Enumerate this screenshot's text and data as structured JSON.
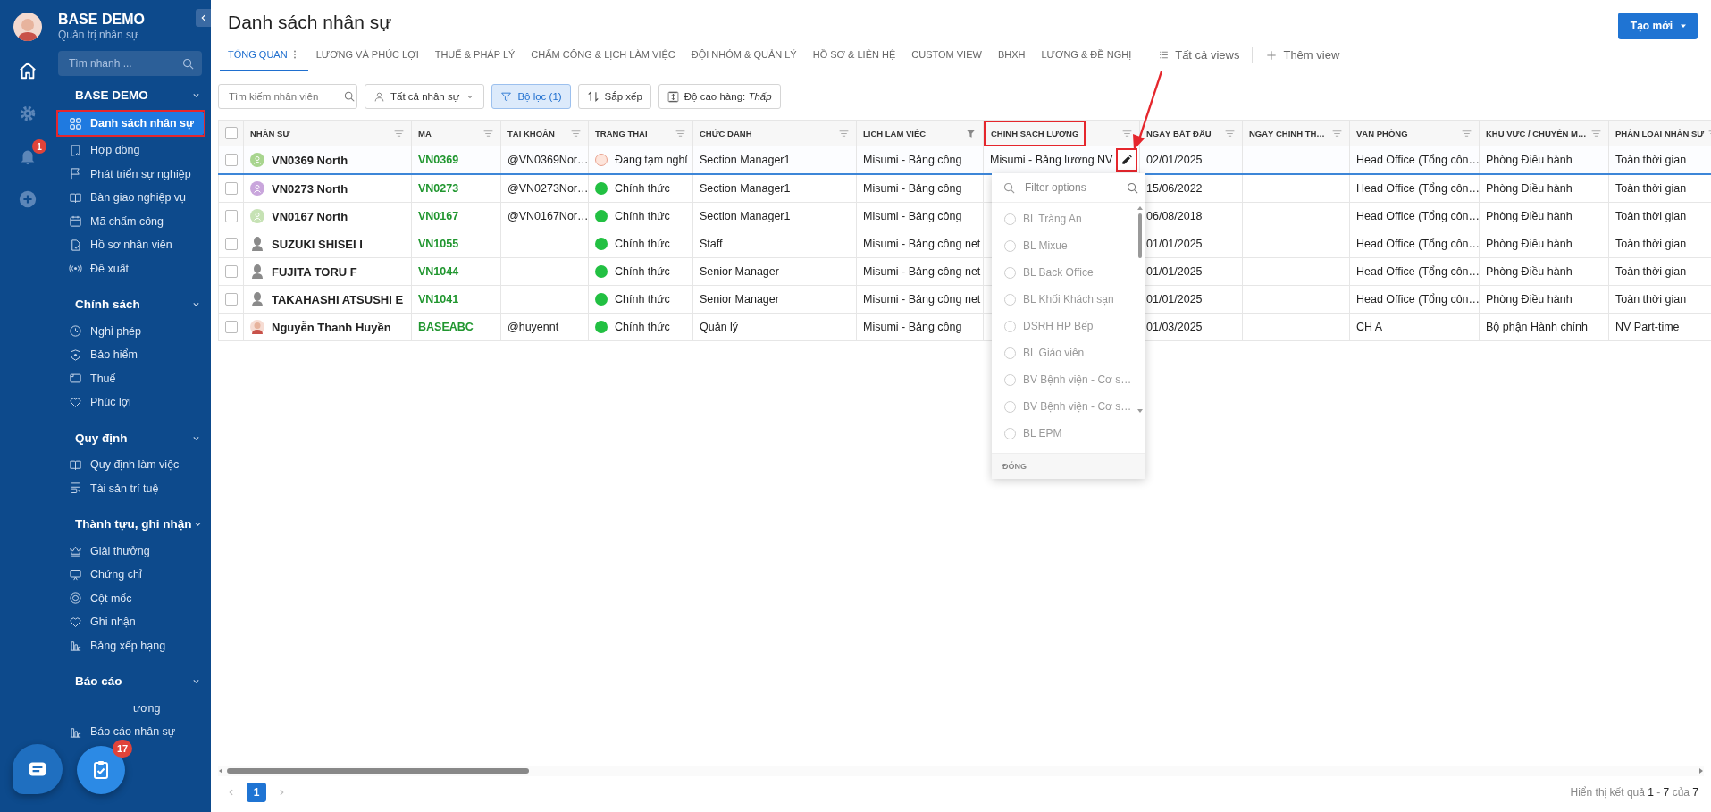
{
  "sidebar": {
    "workspace": "BASE DEMO",
    "subtitle": "Quản trị nhân sự",
    "notification_count": "1",
    "search": {
      "placeholder": "Tìm nhanh ..."
    },
    "sections": [
      {
        "title": "BASE DEMO",
        "expanded": true,
        "items": [
          {
            "label": "Danh sách nhân sự",
            "selected": true,
            "highlighted": true
          },
          {
            "label": "Hợp đồng",
            "selected": false
          },
          {
            "label": "Phát triển sự nghiệp",
            "selected": false
          },
          {
            "label": "Bàn giao nghiệp vụ",
            "selected": false
          },
          {
            "label": "Mã chấm công",
            "selected": false
          },
          {
            "label": "Hồ sơ nhân viên",
            "selected": false
          },
          {
            "label": "Đề xuất",
            "selected": false
          }
        ]
      },
      {
        "title": "Chính sách",
        "expanded": true,
        "items": [
          {
            "label": "Nghỉ phép",
            "selected": false
          },
          {
            "label": "Bảo hiểm",
            "selected": false
          },
          {
            "label": "Thuế",
            "selected": false
          },
          {
            "label": "Phúc lợi",
            "selected": false
          }
        ]
      },
      {
        "title": "Quy định",
        "expanded": true,
        "items": [
          {
            "label": "Quy định làm việc",
            "selected": false
          },
          {
            "label": "Tài sản trí tuệ",
            "selected": false
          }
        ]
      },
      {
        "title": "Thành tựu, ghi nhận",
        "expanded": true,
        "items": [
          {
            "label": "Giải thưởng",
            "selected": false
          },
          {
            "label": "Chứng chỉ",
            "selected": false
          },
          {
            "label": "Cột mốc",
            "selected": false
          },
          {
            "label": "Ghi nhận",
            "selected": false
          },
          {
            "label": "Bảng xếp hạng",
            "selected": false
          }
        ]
      },
      {
        "title": "Báo cáo",
        "expanded": true,
        "items": [
          {
            "label": "ương",
            "selected": false,
            "kind": "covered"
          },
          {
            "label": "Báo cáo nhân sự",
            "selected": false
          }
        ]
      }
    ]
  },
  "floating": {
    "task_count": "17"
  },
  "page": {
    "title": "Danh sách nhân sự",
    "create_button": "Tạo mới"
  },
  "tabs": [
    {
      "label": "TỔNG QUAN",
      "selected": true
    },
    {
      "label": "LƯƠNG VÀ PHÚC LỢI",
      "selected": false
    },
    {
      "label": "THUẾ & PHÁP LÝ",
      "selected": false
    },
    {
      "label": "CHẤM CÔNG & LỊCH LÀM VIỆC",
      "selected": false
    },
    {
      "label": "ĐỘI NHÓM & QUẢN LÝ",
      "selected": false
    },
    {
      "label": "HỒ SƠ & LIÊN HỆ",
      "selected": false
    },
    {
      "label": "CUSTOM VIEW",
      "selected": false
    },
    {
      "label": "BHXH",
      "selected": false
    },
    {
      "label": "LƯƠNG & ĐỀ NGHỊ",
      "selected": false
    }
  ],
  "view_actions": {
    "all_views": "Tất cả views",
    "add_view": "Thêm view"
  },
  "toolbar": {
    "search": {
      "placeholder": "Tìm kiếm nhân viên"
    },
    "scope": "Tất cả nhân sự",
    "filter": {
      "label": "Bộ lọc (1)",
      "active": true
    },
    "sort": "Sắp xếp",
    "row_height": "Độ cao hàng: *Thấp*"
  },
  "table": {
    "all_checked": false,
    "columns": [
      {
        "label": "NHÂN SỰ",
        "filtered": false
      },
      {
        "label": "MÃ",
        "filtered": false
      },
      {
        "label": "TÀI KHOẢN",
        "filtered": false
      },
      {
        "label": "TRẠNG THÁI",
        "filtered": false
      },
      {
        "label": "CHỨC DANH",
        "filtered": false
      },
      {
        "label": "LỊCH LÀM VIỆC",
        "filtered": true
      },
      {
        "label": "CHÍNH SÁCH LƯƠNG",
        "filtered": false,
        "highlighted": true
      },
      {
        "label": "NGÀY BẮT ĐẦU",
        "filtered": false
      },
      {
        "label": "NGÀY CHÍNH TH…",
        "filtered": false
      },
      {
        "label": "VĂN PHÒNG",
        "filtered": false
      },
      {
        "label": "KHU VỰC / CHUYÊN M…",
        "filtered": false
      },
      {
        "label": "PHÂN LOẠI NHÂN SỰ",
        "filtered": false
      }
    ],
    "rows": [
      {
        "checked": false,
        "editing": true,
        "name": "VN0369 North",
        "avatar": {
          "kind": "initial",
          "color": "#a8d58f"
        },
        "code": "VN0369",
        "account": "@VN0369Nor…",
        "status": {
          "label": "Đang tạm nghỉ",
          "kind": "paused"
        },
        "title": "Section Manager1",
        "schedule": "Misumi - Bảng công",
        "policy": "Misumi - Bảng lương NV",
        "start": "02/01/2025",
        "office": "Head Office (Tổng côn…",
        "region": "Phòng Điều hành",
        "type": "Toàn thời gian"
      },
      {
        "checked": false,
        "editing": false,
        "name": "VN0273 North",
        "avatar": {
          "kind": "initial",
          "color": "#c9a6dc"
        },
        "code": "VN0273",
        "account": "@VN0273Nor…",
        "status": {
          "label": "Chính thức",
          "kind": "official"
        },
        "title": "Section Manager1",
        "schedule": "Misumi - Bảng công",
        "start": "15/06/2022",
        "office": "Head Office (Tổng côn…",
        "region": "Phòng Điều hành",
        "type": "Toàn thời gian"
      },
      {
        "checked": false,
        "editing": false,
        "name": "VN0167 North",
        "avatar": {
          "kind": "initial",
          "color": "#c6e2b4"
        },
        "code": "VN0167",
        "account": "@VN0167Nor…",
        "status": {
          "label": "Chính thức",
          "kind": "official"
        },
        "title": "Section Manager1",
        "schedule": "Misumi - Bảng công",
        "start": "06/08/2018",
        "office": "Head Office (Tổng côn…",
        "region": "Phòng Điều hành",
        "type": "Toàn thời gian"
      },
      {
        "checked": false,
        "editing": false,
        "name": "SUZUKI SHISEI I",
        "avatar": {
          "kind": "silhouette"
        },
        "code": "VN1055",
        "status": {
          "label": "Chính thức",
          "kind": "official"
        },
        "title": "Staff",
        "schedule": "Misumi - Bảng công net",
        "start": "01/01/2025",
        "office": "Head Office (Tổng côn…",
        "region": "Phòng Điều hành",
        "type": "Toàn thời gian"
      },
      {
        "checked": false,
        "editing": false,
        "name": "FUJITA TORU F",
        "avatar": {
          "kind": "silhouette"
        },
        "code": "VN1044",
        "status": {
          "label": "Chính thức",
          "kind": "official"
        },
        "title": "Senior Manager",
        "schedule": "Misumi - Bảng công net",
        "start": "01/01/2025",
        "office": "Head Office (Tổng côn…",
        "region": "Phòng Điều hành",
        "type": "Toàn thời gian"
      },
      {
        "checked": false,
        "editing": false,
        "name": "TAKAHASHI ATSUSHI E",
        "avatar": {
          "kind": "silhouette"
        },
        "code": "VN1041",
        "status": {
          "label": "Chính thức",
          "kind": "official"
        },
        "title": "Senior Manager",
        "schedule": "Misumi - Bảng công net",
        "start": "01/01/2025",
        "office": "Head Office (Tổng côn…",
        "region": "Phòng Điều hành",
        "type": "Toàn thời gian"
      },
      {
        "checked": false,
        "editing": false,
        "name": "Nguyễn Thanh Huyền",
        "avatar": {
          "kind": "figure"
        },
        "code": "BASEABC",
        "account": "@huyennt",
        "status": {
          "label": "Chính thức",
          "kind": "official"
        },
        "title": "Quản lý",
        "schedule": "Misumi - Bảng công",
        "start": "01/03/2025",
        "office": "CH A",
        "region": "Bộ phận Hành chính",
        "type": "NV Part-time"
      }
    ]
  },
  "dropdown": {
    "placeholder": "Filter options",
    "options": [
      {
        "label": "BL Tràng An",
        "selected": false
      },
      {
        "label": "BL Mixue",
        "selected": false
      },
      {
        "label": "BL Back Office",
        "selected": false
      },
      {
        "label": "BL Khối Khách sạn",
        "selected": false
      },
      {
        "label": "DSRH HP Bếp",
        "selected": false
      },
      {
        "label": "BL Giáo viên",
        "selected": false
      },
      {
        "label": "BV Bệnh viện - Cơ s…",
        "selected": false
      },
      {
        "label": "BV Bệnh viện - Cơ s…",
        "selected": false
      },
      {
        "label": "BL EPM",
        "selected": false
      }
    ],
    "close": "ĐÓNG"
  },
  "pagination": {
    "pages": [
      {
        "label": "1",
        "selected": true
      }
    ],
    "summary": "Hiển thị kết quả **1** - **7** của **7**"
  }
}
